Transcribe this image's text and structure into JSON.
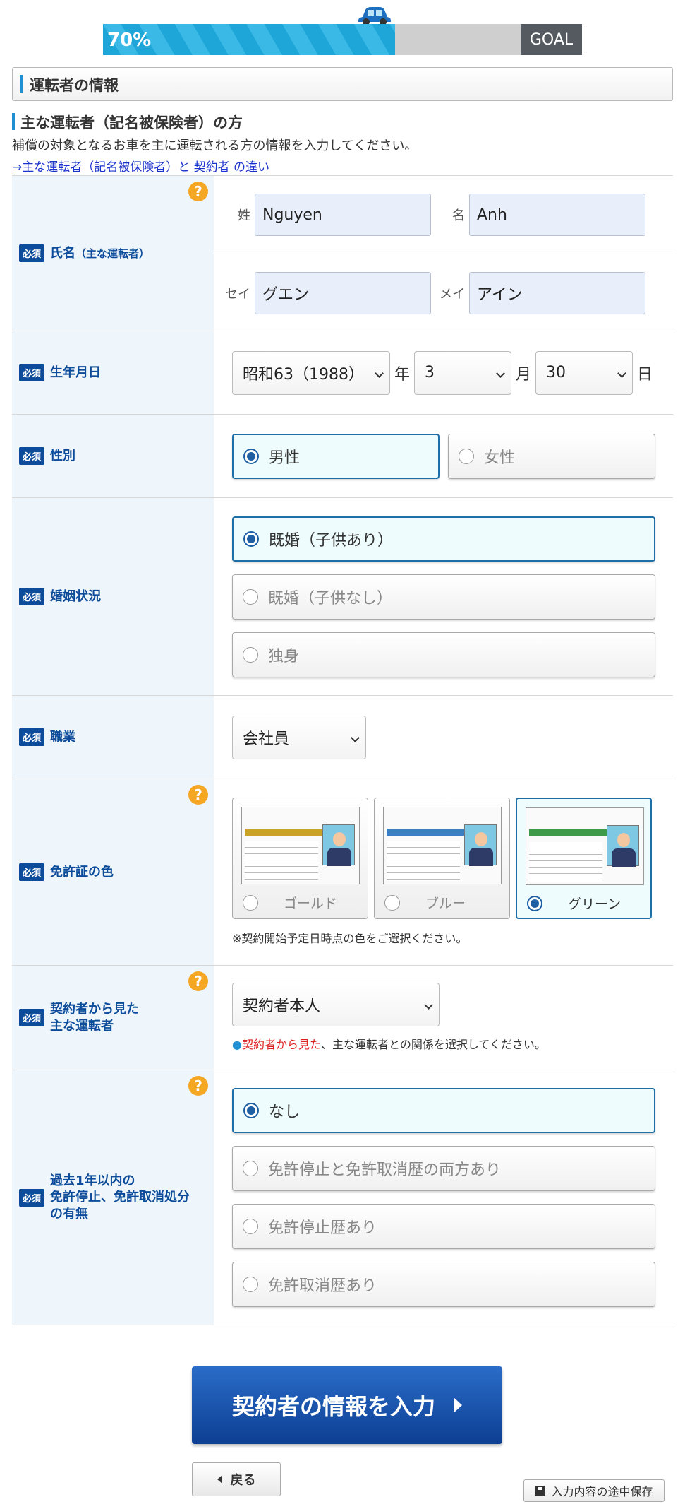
{
  "progress": {
    "percent_label": "70%",
    "fraction": 0.61,
    "goal_label": "GOAL"
  },
  "section": {
    "title": "運転者の情報"
  },
  "subsection": {
    "title": "主な運転者（記名被保険者）の方",
    "description": "補償の対象となるお車を主に運転される方の情報を入力してください。",
    "link": "→主な運転者（記名被保険者）と 契約者 の違い"
  },
  "required_badge": "必須",
  "help_glyph": "?",
  "name": {
    "label": "氏名",
    "label_sub": "（主な運転者）",
    "sei_label": "姓",
    "sei_value": "Nguyen",
    "mei_label": "名",
    "mei_value": "Anh",
    "sei_kana_label": "セイ",
    "sei_kana_value": "グエン",
    "mei_kana_label": "メイ",
    "mei_kana_value": "アイン"
  },
  "birth": {
    "label": "生年月日",
    "year": "昭和63（1988）",
    "year_unit": "年",
    "month": "3",
    "month_unit": "月",
    "day": "30",
    "day_unit": "日"
  },
  "gender": {
    "label": "性別",
    "options": [
      {
        "label": "男性",
        "selected": true
      },
      {
        "label": "女性",
        "selected": false
      }
    ]
  },
  "marital": {
    "label": "婚姻状況",
    "options": [
      {
        "label": "既婚（子供あり）",
        "selected": true
      },
      {
        "label": "既婚（子供なし）",
        "selected": false
      },
      {
        "label": "独身",
        "selected": false
      }
    ]
  },
  "occupation": {
    "label": "職業",
    "value": "会社員"
  },
  "license": {
    "label": "免許証の色",
    "options": [
      {
        "label": "ゴールド",
        "band_color": "#c9a227",
        "selected": false
      },
      {
        "label": "ブルー",
        "band_color": "#3a7fc1",
        "selected": false
      },
      {
        "label": "グリーン",
        "band_color": "#3f9a4a",
        "selected": true
      }
    ],
    "note": "※契約開始予定日時点の色をご選択ください。"
  },
  "relation": {
    "label_line1": "契約者から見た",
    "label_line2": "主な運転者",
    "value": "契約者本人",
    "note_bullet": "●",
    "note_red": "契約者から見た",
    "note_rest": "、主な運転者との関係を選択してください。"
  },
  "suspension": {
    "label_line1": "過去1年以内の",
    "label_line2": "免許停止、免許取消処分",
    "label_line3": "の有無",
    "options": [
      {
        "label": "なし",
        "selected": true
      },
      {
        "label": "免許停止と免許取消歴の両方あり",
        "selected": false
      },
      {
        "label": "免許停止歴あり",
        "selected": false
      },
      {
        "label": "免許取消歴あり",
        "selected": false
      }
    ]
  },
  "buttons": {
    "submit": "契約者の情報を入力",
    "back": "戻る",
    "save": "入力内容の途中保存"
  },
  "colors": {
    "accent": "#0d4c9a",
    "progress": "#1ea6d8",
    "help": "#f5a623"
  }
}
